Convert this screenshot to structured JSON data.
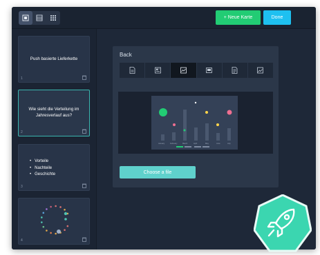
{
  "toolbar": {
    "view_modes": [
      "card-view-icon",
      "list-view-icon",
      "grid-view-icon"
    ],
    "new_card_label": "+ Neue Karte",
    "done_label": "Done"
  },
  "sidebar": {
    "cards": [
      {
        "number": "1",
        "text": "Push basierte Lieferkette"
      },
      {
        "number": "2",
        "text": "Wie sieht die Verteilung im Jahresverlauf aus?"
      },
      {
        "number": "3",
        "bullets": [
          "Vorteile",
          "Nachteile",
          "Geschichte"
        ]
      },
      {
        "number": "4",
        "content": "radial-chart-thumbnail"
      }
    ]
  },
  "editor": {
    "side_label": "Back",
    "content_types": [
      "text-icon",
      "text-image-icon",
      "chart-icon",
      "media-icon",
      "document-icon",
      "image-icon"
    ],
    "upload_label": "Choose a file"
  },
  "colors": {
    "accent_green": "#22cc74",
    "accent_blue": "#1ec0f0",
    "accent_teal": "#5fd1cc",
    "background": "#1d2736"
  },
  "badge_icon": "rocket-icon"
}
